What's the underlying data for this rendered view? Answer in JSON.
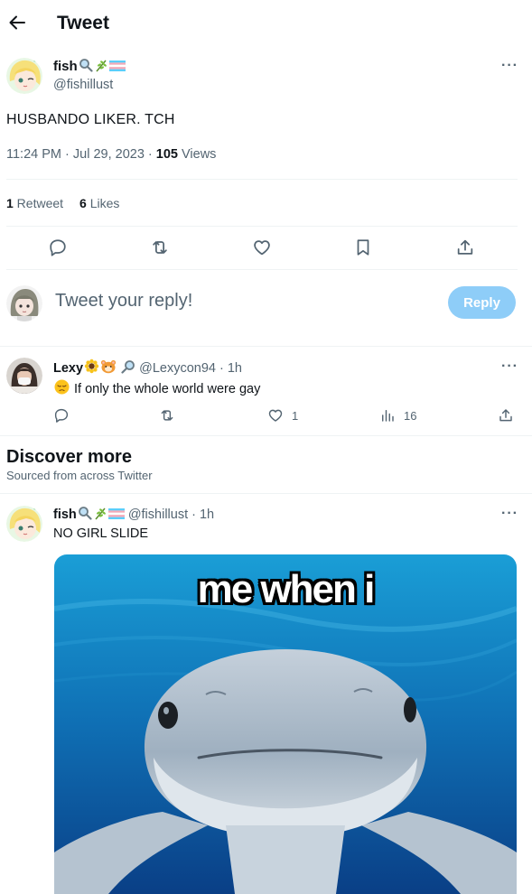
{
  "header": {
    "title": "Tweet"
  },
  "main_tweet": {
    "display_name": "fish",
    "handle": "@fishillust",
    "text": "HUSBANDO LIKER. TCH",
    "time": "11:24 PM · Jul 29, 2023 · ",
    "views_count": "105",
    "views_label": " Views",
    "retweets_count": "1",
    "retweets_label": " Retweet",
    "likes_count": "6",
    "likes_label": " Likes"
  },
  "composer": {
    "placeholder": "Tweet your reply!",
    "button_label": "Reply"
  },
  "reply": {
    "display_name": "Lexy",
    "handle": "@Lexycon94 · 1h",
    "text": "If only the whole world were gay",
    "likes": "1",
    "views": "16"
  },
  "discover": {
    "title": "Discover more",
    "subtitle": "Sourced from across Twitter"
  },
  "suggested_tweet": {
    "display_name": "fish",
    "handle": "@fishillust · 1h",
    "text": "NO GIRL SLIDE",
    "media_caption": "me when i"
  },
  "more_glyph": "···",
  "colors": {
    "accent_disabled": "#8ecdf8",
    "secondary_text": "#536471",
    "divider": "#eff3f4"
  },
  "icons": [
    "back-arrow-icon",
    "reply-icon",
    "retweet-icon",
    "like-icon",
    "bookmark-icon",
    "share-icon",
    "views-icon",
    "magnifier-emoji",
    "herb-emoji",
    "trans-flag-emoji",
    "sunflower-emoji",
    "hamster-emoji",
    "pensive-emoji"
  ]
}
